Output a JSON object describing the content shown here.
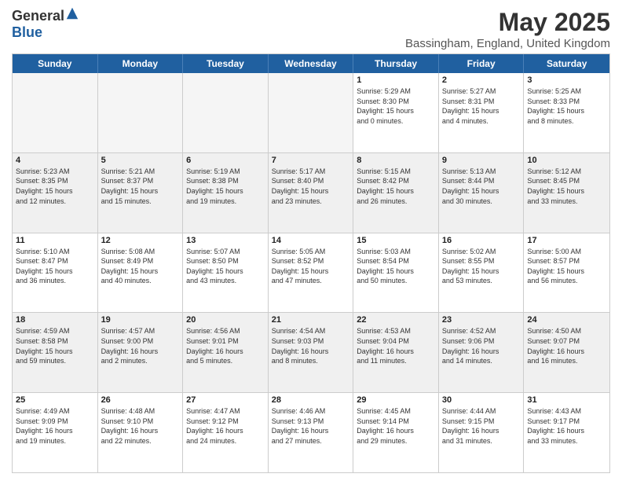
{
  "logo": {
    "general": "General",
    "blue": "Blue"
  },
  "title": "May 2025",
  "subtitle": "Bassingham, England, United Kingdom",
  "weekdays": [
    "Sunday",
    "Monday",
    "Tuesday",
    "Wednesday",
    "Thursday",
    "Friday",
    "Saturday"
  ],
  "rows": [
    [
      {
        "day": "",
        "empty": true
      },
      {
        "day": "",
        "empty": true
      },
      {
        "day": "",
        "empty": true
      },
      {
        "day": "",
        "empty": true
      },
      {
        "day": "1",
        "info": "Sunrise: 5:29 AM\nSunset: 8:30 PM\nDaylight: 15 hours\nand 0 minutes."
      },
      {
        "day": "2",
        "info": "Sunrise: 5:27 AM\nSunset: 8:31 PM\nDaylight: 15 hours\nand 4 minutes."
      },
      {
        "day": "3",
        "info": "Sunrise: 5:25 AM\nSunset: 8:33 PM\nDaylight: 15 hours\nand 8 minutes."
      }
    ],
    [
      {
        "day": "4",
        "info": "Sunrise: 5:23 AM\nSunset: 8:35 PM\nDaylight: 15 hours\nand 12 minutes."
      },
      {
        "day": "5",
        "info": "Sunrise: 5:21 AM\nSunset: 8:37 PM\nDaylight: 15 hours\nand 15 minutes."
      },
      {
        "day": "6",
        "info": "Sunrise: 5:19 AM\nSunset: 8:38 PM\nDaylight: 15 hours\nand 19 minutes."
      },
      {
        "day": "7",
        "info": "Sunrise: 5:17 AM\nSunset: 8:40 PM\nDaylight: 15 hours\nand 23 minutes."
      },
      {
        "day": "8",
        "info": "Sunrise: 5:15 AM\nSunset: 8:42 PM\nDaylight: 15 hours\nand 26 minutes."
      },
      {
        "day": "9",
        "info": "Sunrise: 5:13 AM\nSunset: 8:44 PM\nDaylight: 15 hours\nand 30 minutes."
      },
      {
        "day": "10",
        "info": "Sunrise: 5:12 AM\nSunset: 8:45 PM\nDaylight: 15 hours\nand 33 minutes."
      }
    ],
    [
      {
        "day": "11",
        "info": "Sunrise: 5:10 AM\nSunset: 8:47 PM\nDaylight: 15 hours\nand 36 minutes."
      },
      {
        "day": "12",
        "info": "Sunrise: 5:08 AM\nSunset: 8:49 PM\nDaylight: 15 hours\nand 40 minutes."
      },
      {
        "day": "13",
        "info": "Sunrise: 5:07 AM\nSunset: 8:50 PM\nDaylight: 15 hours\nand 43 minutes."
      },
      {
        "day": "14",
        "info": "Sunrise: 5:05 AM\nSunset: 8:52 PM\nDaylight: 15 hours\nand 47 minutes."
      },
      {
        "day": "15",
        "info": "Sunrise: 5:03 AM\nSunset: 8:54 PM\nDaylight: 15 hours\nand 50 minutes."
      },
      {
        "day": "16",
        "info": "Sunrise: 5:02 AM\nSunset: 8:55 PM\nDaylight: 15 hours\nand 53 minutes."
      },
      {
        "day": "17",
        "info": "Sunrise: 5:00 AM\nSunset: 8:57 PM\nDaylight: 15 hours\nand 56 minutes."
      }
    ],
    [
      {
        "day": "18",
        "info": "Sunrise: 4:59 AM\nSunset: 8:58 PM\nDaylight: 15 hours\nand 59 minutes."
      },
      {
        "day": "19",
        "info": "Sunrise: 4:57 AM\nSunset: 9:00 PM\nDaylight: 16 hours\nand 2 minutes."
      },
      {
        "day": "20",
        "info": "Sunrise: 4:56 AM\nSunset: 9:01 PM\nDaylight: 16 hours\nand 5 minutes."
      },
      {
        "day": "21",
        "info": "Sunrise: 4:54 AM\nSunset: 9:03 PM\nDaylight: 16 hours\nand 8 minutes."
      },
      {
        "day": "22",
        "info": "Sunrise: 4:53 AM\nSunset: 9:04 PM\nDaylight: 16 hours\nand 11 minutes."
      },
      {
        "day": "23",
        "info": "Sunrise: 4:52 AM\nSunset: 9:06 PM\nDaylight: 16 hours\nand 14 minutes."
      },
      {
        "day": "24",
        "info": "Sunrise: 4:50 AM\nSunset: 9:07 PM\nDaylight: 16 hours\nand 16 minutes."
      }
    ],
    [
      {
        "day": "25",
        "info": "Sunrise: 4:49 AM\nSunset: 9:09 PM\nDaylight: 16 hours\nand 19 minutes."
      },
      {
        "day": "26",
        "info": "Sunrise: 4:48 AM\nSunset: 9:10 PM\nDaylight: 16 hours\nand 22 minutes."
      },
      {
        "day": "27",
        "info": "Sunrise: 4:47 AM\nSunset: 9:12 PM\nDaylight: 16 hours\nand 24 minutes."
      },
      {
        "day": "28",
        "info": "Sunrise: 4:46 AM\nSunset: 9:13 PM\nDaylight: 16 hours\nand 27 minutes."
      },
      {
        "day": "29",
        "info": "Sunrise: 4:45 AM\nSunset: 9:14 PM\nDaylight: 16 hours\nand 29 minutes."
      },
      {
        "day": "30",
        "info": "Sunrise: 4:44 AM\nSunset: 9:15 PM\nDaylight: 16 hours\nand 31 minutes."
      },
      {
        "day": "31",
        "info": "Sunrise: 4:43 AM\nSunset: 9:17 PM\nDaylight: 16 hours\nand 33 minutes."
      }
    ]
  ]
}
